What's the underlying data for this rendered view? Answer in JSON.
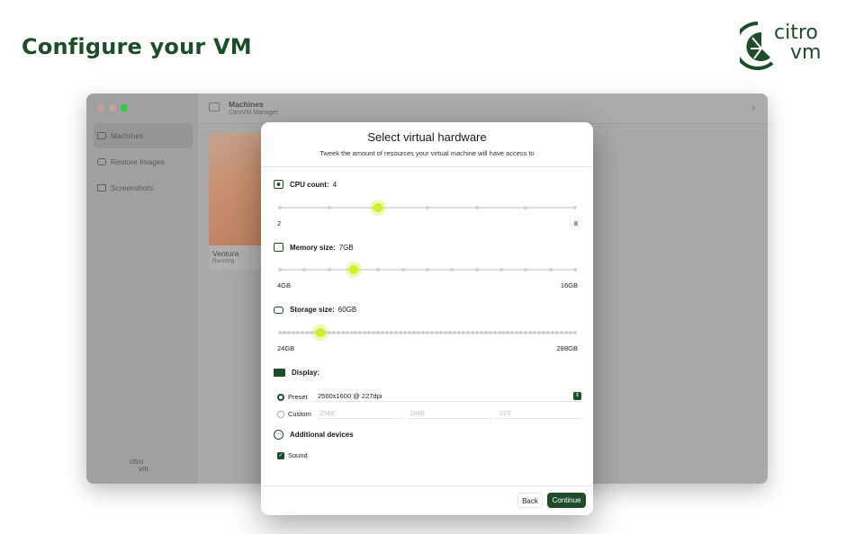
{
  "page": {
    "title": "Configure your VM"
  },
  "brand": {
    "line1": "citro",
    "line2": "vm"
  },
  "window": {
    "sidebar": {
      "items": [
        {
          "label": "Machines",
          "icon": "display-icon",
          "active": true
        },
        {
          "label": "Restore Images",
          "icon": "drive-icon",
          "active": false
        },
        {
          "label": "Screenshots",
          "icon": "image-icon",
          "active": false
        }
      ],
      "logo_line1": "citro",
      "logo_line2": "vm"
    },
    "toolbar": {
      "title": "Machines",
      "subtitle": "CitroVM Manager",
      "add": "+"
    },
    "vm": {
      "name": "Ventura",
      "status": "Running"
    }
  },
  "modal": {
    "title": "Select virtual hardware",
    "subtitle": "Tweek the amount of resources your virtual machine will have access to",
    "cpu": {
      "label": "CPU count:",
      "value": "4",
      "min_label": "2",
      "max_label": "8",
      "min": 2,
      "max": 8,
      "current": 4
    },
    "memory": {
      "label": "Memory size:",
      "value": "7GB",
      "min_label": "4GB",
      "max_label": "16GB",
      "min": 4,
      "max": 16,
      "current": 7
    },
    "storage": {
      "label": "Storage size:",
      "value": "60GB",
      "min_label": "24GB",
      "max_label": "288GB",
      "min": 24,
      "max": 288,
      "current": 60
    },
    "display": {
      "label": "Display:",
      "preset_label": "Preset",
      "preset_value": "2560x1600 @ 227dpi",
      "custom_label": "Custom",
      "custom_width": "2560",
      "custom_height": "1600",
      "custom_dpi": "227"
    },
    "devices": {
      "label": "Additional devices",
      "sound_label": "Sound",
      "sound_checked": true
    },
    "back_label": "Back",
    "continue_label": "Continue"
  },
  "colors": {
    "brand": "#1e4d2b",
    "accent": "#c9f22a"
  }
}
